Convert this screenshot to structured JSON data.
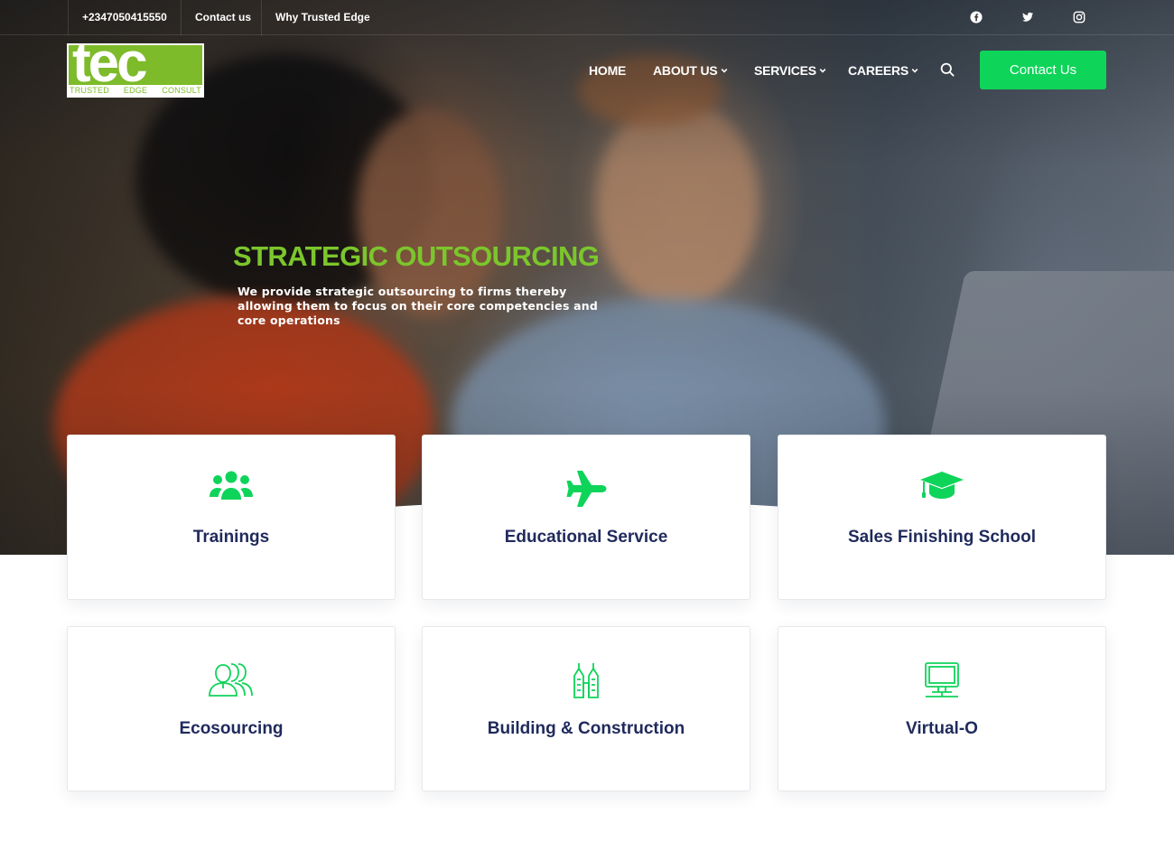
{
  "topbar": {
    "phone": "+2347050415550",
    "contact_link": "Contact us",
    "why_link": "Why Trusted Edge",
    "social": [
      "facebook-icon",
      "twitter-icon",
      "instagram-icon"
    ]
  },
  "logo": {
    "mark": "tec",
    "words": [
      "TRUSTED",
      "EDGE",
      "CONSULT"
    ]
  },
  "nav": {
    "items": [
      {
        "label": "HOME",
        "has_dropdown": false
      },
      {
        "label": "ABOUT US",
        "has_dropdown": true
      },
      {
        "label": "SERVICES",
        "has_dropdown": true
      },
      {
        "label": "CAREERS",
        "has_dropdown": true
      }
    ],
    "cta": "Contact Us"
  },
  "hero": {
    "title": "STRATEGIC OUTSOURCING",
    "description": "We provide strategic outsourcing to firms thereby allowing them to focus on their core competencies and core operations"
  },
  "services": [
    {
      "title": "Trainings",
      "icon": "users-icon"
    },
    {
      "title": "Educational Service",
      "icon": "plane-icon"
    },
    {
      "title": "Sales Finishing School",
      "icon": "graduation-cap-icon"
    },
    {
      "title": "Ecosourcing",
      "icon": "people-outline-icon"
    },
    {
      "title": "Building & Construction",
      "icon": "buildings-icon"
    },
    {
      "title": "Virtual-O",
      "icon": "computer-icon"
    }
  ],
  "colors": {
    "accent_green": "#0ed45a",
    "hero_title_green": "#7bc62c",
    "card_title_navy": "#1f2a5c"
  }
}
